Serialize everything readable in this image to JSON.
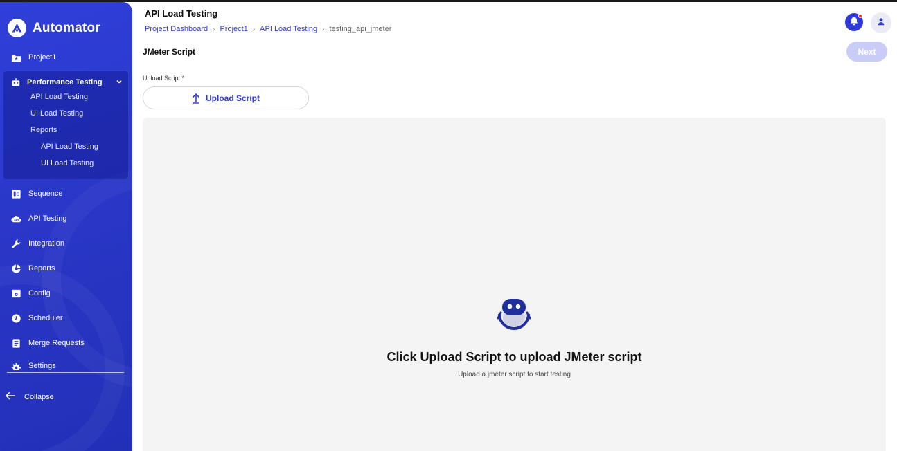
{
  "app": {
    "name": "Automator"
  },
  "sidebar": {
    "project": {
      "label": "Project1",
      "icon": "folder-star-icon"
    },
    "performance": {
      "label": "Performance Testing",
      "icon": "robot-icon",
      "items": [
        {
          "label": "API Load Testing"
        },
        {
          "label": "UI Load Testing"
        },
        {
          "label": "Reports"
        },
        {
          "label": "API Load Testing"
        },
        {
          "label": "UI Load Testing"
        }
      ]
    },
    "items": [
      {
        "label": "Sequence",
        "icon": "document-list-icon"
      },
      {
        "label": "API Testing",
        "icon": "cloud-api-icon"
      },
      {
        "label": "Integration",
        "icon": "wrench-icon"
      },
      {
        "label": "Reports",
        "icon": "pie-chart-icon"
      },
      {
        "label": "Config",
        "icon": "config-icon"
      },
      {
        "label": "Scheduler",
        "icon": "clock-icon"
      },
      {
        "label": "Merge Requests",
        "icon": "merge-icon"
      },
      {
        "label": "Settings",
        "icon": "gear-icon"
      }
    ],
    "collapse_label": "Collapse"
  },
  "header": {
    "title": "API Load Testing",
    "breadcrumb": [
      "Project Dashboard",
      "Project1",
      "API Load Testing",
      "testing_api_jmeter"
    ]
  },
  "main": {
    "section_title": "JMeter Script",
    "next_label": "Next",
    "upload_label": "Upload Script *",
    "upload_button": "Upload Script",
    "empty_title": "Click Upload Script to upload JMeter script",
    "empty_subtitle": "Upload a jmeter script to start testing"
  },
  "colors": {
    "accent": "#2f3ad6",
    "sidebar": "#2a37c8",
    "notification": "#ff2a2a"
  }
}
